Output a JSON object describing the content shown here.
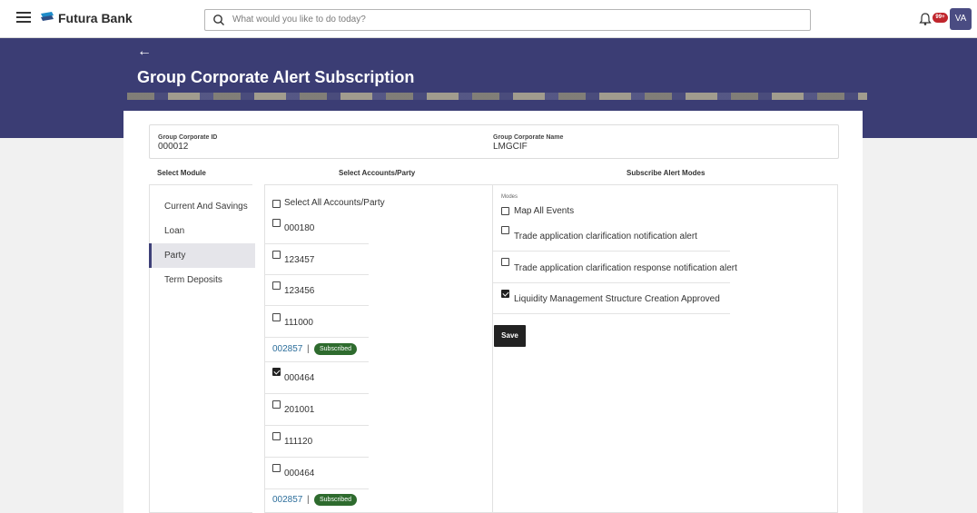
{
  "app": {
    "brand": "Futura Bank",
    "avatar_initials": "VA",
    "notification_count": "99+"
  },
  "search": {
    "placeholder": "What would you like to do today?"
  },
  "page": {
    "title": "Group Corporate Alert Subscription",
    "back_glyph": "←"
  },
  "group": {
    "id_label": "Group Corporate ID",
    "id_value": "000012",
    "name_label": "Group Corporate Name",
    "name_value": "LMGCIF"
  },
  "columns": {
    "module": "Select Module",
    "accounts": "Select Accounts/Party",
    "alerts": "Subscribe Alert Modes"
  },
  "modules": [
    {
      "label": "Current And Savings",
      "active": false
    },
    {
      "label": "Loan",
      "active": false
    },
    {
      "label": "Party",
      "active": true
    },
    {
      "label": "Term Deposits",
      "active": false
    }
  ],
  "accounts": {
    "select_all_label": "Select All Accounts/Party",
    "items": [
      {
        "type": "checkbox",
        "label": "000180",
        "checked": false
      },
      {
        "type": "checkbox",
        "label": "123457",
        "checked": false
      },
      {
        "type": "checkbox",
        "label": "123456",
        "checked": false
      },
      {
        "type": "checkbox",
        "label": "111000",
        "checked": false
      },
      {
        "type": "subscribed",
        "label": "002857",
        "separator": "|",
        "badge": "Subscribed"
      },
      {
        "type": "checkbox",
        "label": "000464",
        "checked": true
      },
      {
        "type": "checkbox",
        "label": "201001",
        "checked": false
      },
      {
        "type": "checkbox",
        "label": "111120",
        "checked": false
      },
      {
        "type": "checkbox",
        "label": "000464",
        "checked": false
      },
      {
        "type": "subscribed",
        "label": "002857",
        "separator": "|",
        "badge": "Subscribed"
      }
    ]
  },
  "alerts": {
    "modes_label": "Modes",
    "map_all_label": "Map All Events",
    "items": [
      {
        "label": "Trade application clarification notification alert",
        "checked": false
      },
      {
        "label": "Trade application clarification response notification alert",
        "checked": false
      },
      {
        "label": "Liquidity Management Structure Creation Approved",
        "checked": true
      }
    ],
    "save_label": "Save"
  },
  "colors": {
    "banner": "#3b3d74",
    "subscribed_badge": "#2e6b2e",
    "link": "#2c6e9b",
    "badge_red": "#c0262d"
  },
  "icons": [
    "hamburger-icon",
    "bank-logo-icon",
    "search-icon",
    "bell-icon",
    "back-arrow-icon",
    "checkbox-icon",
    "checked-checkbox-icon"
  ]
}
